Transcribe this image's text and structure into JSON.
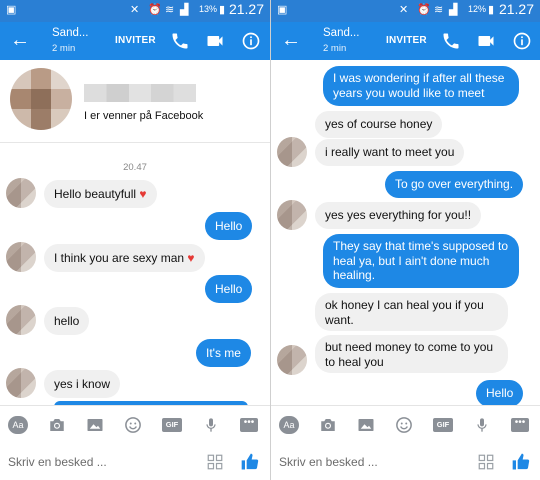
{
  "left": {
    "status": {
      "battery": "13%",
      "time": "21.27"
    },
    "header": {
      "contact": "Sand...",
      "subtitle": "2 min",
      "invite": "INVITER"
    },
    "profile": {
      "friends_text": "I er venner på Facebook"
    },
    "timestamp": "20.47",
    "messages": [
      {
        "side": "in",
        "text": "Hello beautyfull",
        "heart": true
      },
      {
        "side": "out",
        "text": "Hello"
      },
      {
        "side": "in",
        "text": "I think you are sexy man",
        "heart": true
      },
      {
        "side": "out",
        "text": "Hello"
      },
      {
        "side": "in",
        "text": "hello"
      },
      {
        "side": "out",
        "text": "It's me"
      },
      {
        "side": "in",
        "text": "yes i know"
      }
    ],
    "composer": {
      "placeholder": "Skriv en besked ..."
    }
  },
  "right": {
    "status": {
      "battery": "12%",
      "time": "21.27"
    },
    "header": {
      "contact": "Sand...",
      "subtitle": "2 min",
      "invite": "INVITER"
    },
    "messages": [
      {
        "side": "out",
        "text": "I was wondering if after all these years you would like to meet"
      },
      {
        "side": "in",
        "text": "yes of course honey"
      },
      {
        "side": "in",
        "text": "i really want to meet you"
      },
      {
        "side": "out",
        "text": "To go over everything."
      },
      {
        "side": "in",
        "text": "yes yes everything for you!!"
      },
      {
        "side": "out",
        "text": "They say that time's supposed to heal ya, but I ain't done much healing."
      },
      {
        "side": "in",
        "text": "ok honey I can heal you if you want."
      },
      {
        "side": "in",
        "text": "but need money to come to you to heal you"
      },
      {
        "side": "out",
        "text": "Hello"
      }
    ],
    "composer": {
      "placeholder": "Skriv en besked ..."
    }
  },
  "toolbar": {
    "icons": [
      "text-format-icon",
      "camera-icon",
      "image-icon",
      "emoji-icon",
      "gif-icon",
      "microphone-icon",
      "more-icon"
    ],
    "text_format_label": "Aa",
    "gif_label": "GIF"
  },
  "colors": {
    "status_bar": "#2a7fd4",
    "app_bar": "#1e88e5",
    "outgoing_bubble": "#1e88e5",
    "incoming_bubble": "#f0f0f0",
    "heart": "#e53935"
  }
}
